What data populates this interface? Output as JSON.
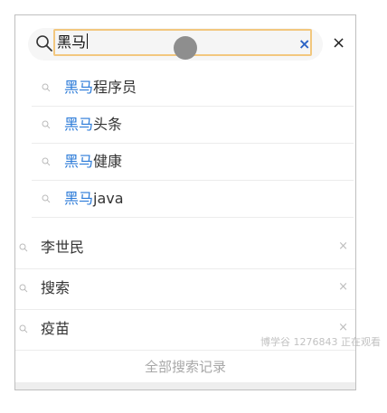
{
  "search": {
    "query": "黑马",
    "clear_symbol": "×",
    "close_symbol": "×"
  },
  "suggestions": [
    {
      "highlight": "黑马",
      "rest": "程序员"
    },
    {
      "highlight": "黑马",
      "rest": "头条"
    },
    {
      "highlight": "黑马",
      "rest": "健康"
    },
    {
      "highlight": "黑马",
      "rest": "java"
    }
  ],
  "history": [
    {
      "label": "李世民",
      "delete": "×"
    },
    {
      "label": "搜索",
      "delete": "×"
    },
    {
      "label": "疫苗",
      "delete": "×"
    }
  ],
  "footer": {
    "all_history_label": "全部搜索记录"
  },
  "watermark": "博学谷 1276843 正在观看",
  "colors": {
    "highlight": "#2a7ad8",
    "input_border": "#f2c77e",
    "clear_x": "#2a63c6"
  },
  "icons": {
    "search": "search-icon",
    "clear": "clear-icon",
    "close": "close-icon"
  }
}
